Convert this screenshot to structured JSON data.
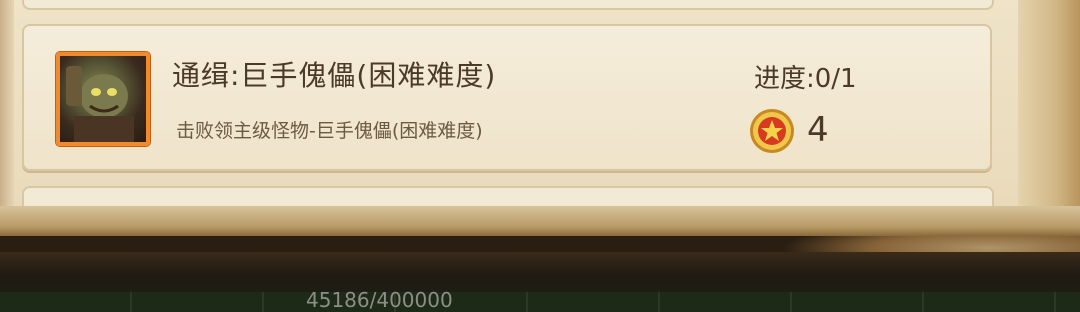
{
  "task": {
    "title": "通缉:巨手傀儡(困难难度)",
    "description": "击败领主级怪物-巨手傀儡(困难难度)",
    "progress_label": "进度:0/1",
    "progress": {
      "current": 0,
      "total": 1
    },
    "reward": {
      "icon": "star-medal-icon",
      "value": "4"
    },
    "avatar_icon": "golem-boss-portrait"
  },
  "footer": {
    "hp_text": "45186/400000"
  },
  "colors": {
    "parchment": "#efe3c8",
    "text_primary": "#4b3a28",
    "avatar_border": "#f08a2c",
    "reward_red": "#d63b1f",
    "reward_gold": "#e8b03a"
  }
}
